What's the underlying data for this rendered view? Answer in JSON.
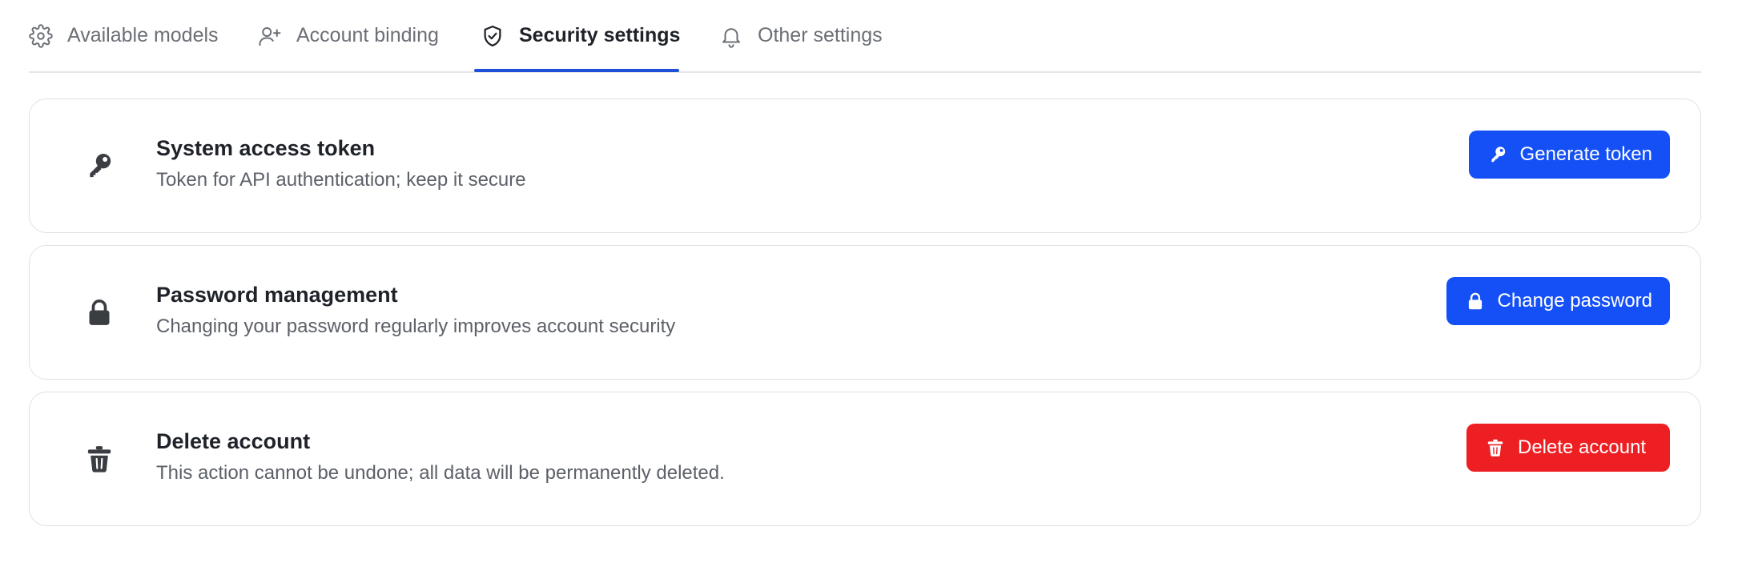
{
  "tabs": {
    "items": [
      {
        "label": "Available models",
        "icon": "gear-icon"
      },
      {
        "label": "Account binding",
        "icon": "user-plus-icon"
      },
      {
        "label": "Security settings",
        "icon": "shield-check-icon"
      },
      {
        "label": "Other settings",
        "icon": "bell-icon"
      }
    ],
    "active": "Security settings"
  },
  "cards": {
    "token": {
      "icon": "key-icon",
      "title": "System access token",
      "description": "Token for API authentication; keep it secure",
      "button_label": "Generate token",
      "button_icon": "key-icon"
    },
    "password": {
      "icon": "lock-icon",
      "title": "Password management",
      "description": "Changing your password regularly improves account security",
      "button_label": "Change password",
      "button_icon": "lock-icon"
    },
    "delete": {
      "icon": "trash-icon",
      "title": "Delete account",
      "description": "This action cannot be undone; all data will be permanently deleted.",
      "button_label": "Delete account",
      "button_icon": "trash-icon"
    }
  },
  "colors": {
    "accent": "#1450f5",
    "tab_underline": "#1d4fd8",
    "danger": "#ee1f23",
    "icon_dark": "#3a3d42"
  }
}
